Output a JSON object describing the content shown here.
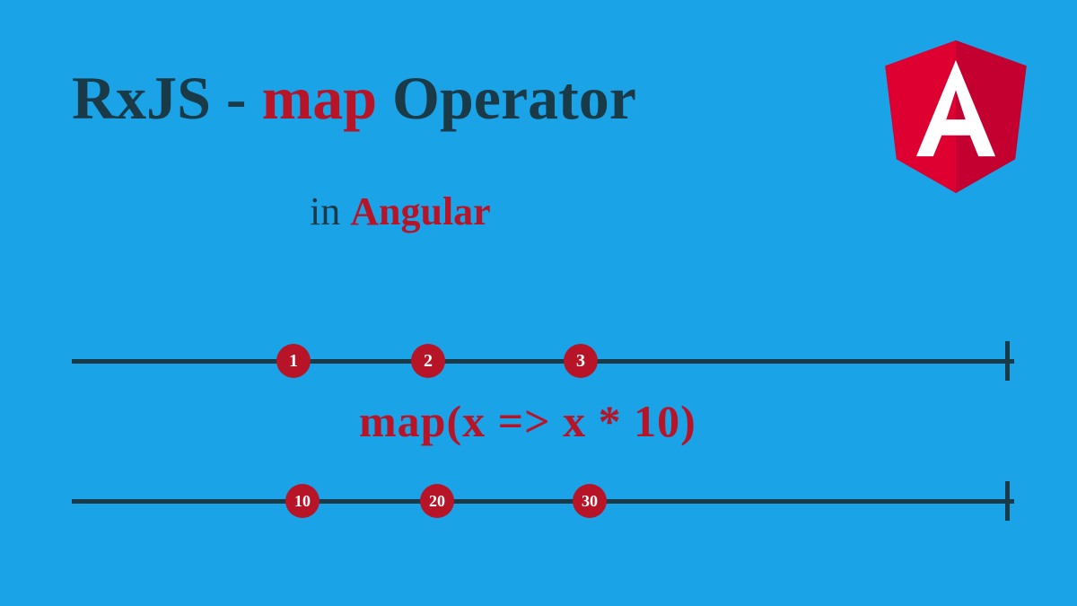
{
  "title": {
    "part1": "RxJS - ",
    "part2": "map",
    "part3": " Operator"
  },
  "subtitle": {
    "part1": "in ",
    "part2": "Angular"
  },
  "operator_expression": "map(x => x * 10)",
  "timelines": {
    "input": {
      "marbles": [
        "1",
        "2",
        "3"
      ]
    },
    "output": {
      "marbles": [
        "10",
        "20",
        "30"
      ]
    }
  },
  "logo_letter": "A"
}
